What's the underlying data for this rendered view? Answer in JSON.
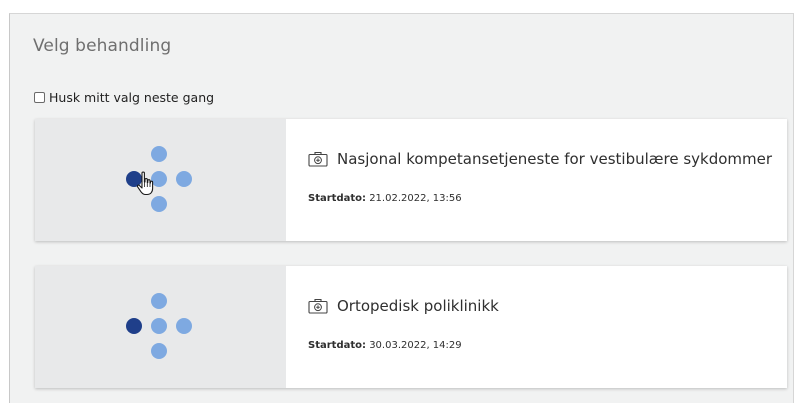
{
  "panel": {
    "title": "Velg behandling",
    "remember_label": "Husk mitt valg neste gang"
  },
  "colors": {
    "dot_light": "#7ea9e1",
    "dot_dark": "#1f3f8a",
    "card_left_bg": "#e8e9ea",
    "panel_bg": "#f1f2f2"
  },
  "cards": [
    {
      "title": "Nasjonal kompetansetjeneste for vestibulære sykdommer",
      "start_label": "Startdato:",
      "start_value": "21.02.2022, 13:56",
      "icon": "medical-kit-icon",
      "logo": "dots-cross-logo"
    },
    {
      "title": "Ortopedisk poliklinikk",
      "start_label": "Startdato:",
      "start_value": "30.03.2022, 14:29",
      "icon": "medical-kit-icon",
      "logo": "dots-cross-logo"
    }
  ]
}
